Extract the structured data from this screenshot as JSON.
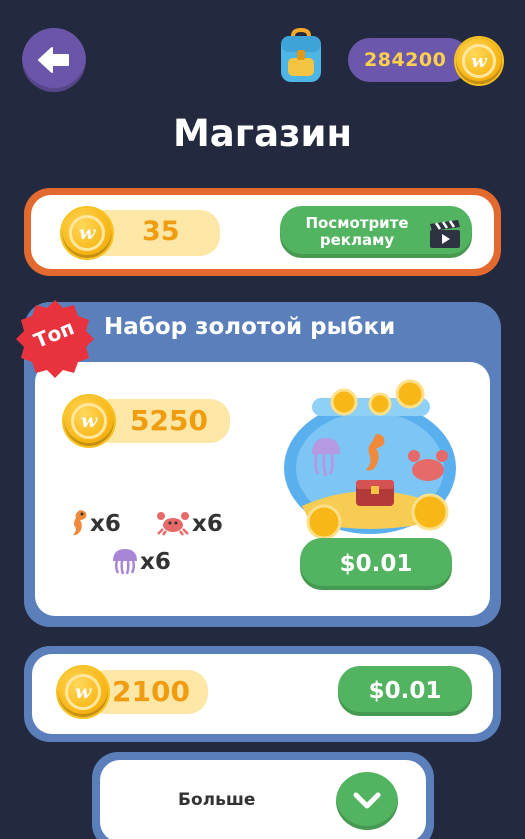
{
  "header": {
    "title": "Магазин",
    "balance": "284200",
    "back_icon": "back-arrow-icon",
    "bag_icon": "backpack-icon"
  },
  "ad_offer": {
    "coins": "35",
    "button_label_line1": "Посмотрите",
    "button_label_line2": "рекламу",
    "icon": "clapperboard-icon"
  },
  "gold_fish_pack": {
    "badge": "Топ",
    "title": "Набор золотой рыбки",
    "coins": "5250",
    "items": [
      {
        "icon": "seahorse-icon",
        "qty": "x6"
      },
      {
        "icon": "crab-icon",
        "qty": "x6"
      },
      {
        "icon": "jellyfish-icon",
        "qty": "x6"
      }
    ],
    "price": "$0.01"
  },
  "coin_pack": {
    "coins": "2100",
    "price": "$0.01"
  },
  "more": {
    "label": "Больше",
    "icon": "chevron-down-icon"
  },
  "colors": {
    "background": "#232a40",
    "accent_purple": "#6a55a8",
    "orange_frame": "#e36a2f",
    "blue_frame": "#5b7fbb",
    "green_button": "#52b460",
    "coin_gold": "#f8b717"
  }
}
